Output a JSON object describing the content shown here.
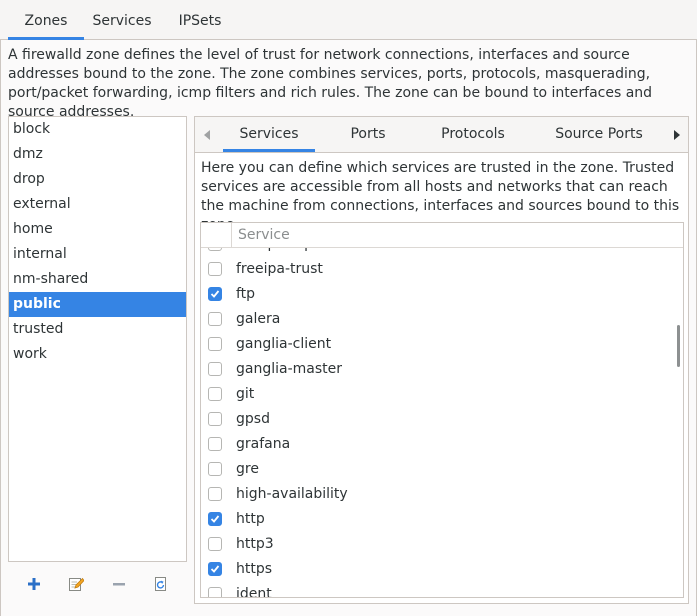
{
  "top_tabs": [
    {
      "label": "Zones",
      "active": true
    },
    {
      "label": "Services",
      "active": false
    },
    {
      "label": "IPSets",
      "active": false
    }
  ],
  "zones_description": "A firewalld zone defines the level of trust for network connections, interfaces and source addresses bound to the zone. The zone combines services, ports, protocols, masquerading, port/packet forwarding, icmp filters and rich rules. The zone can be bound to interfaces and source addresses.",
  "zones": [
    {
      "label": "block"
    },
    {
      "label": "dmz"
    },
    {
      "label": "drop"
    },
    {
      "label": "external"
    },
    {
      "label": "home"
    },
    {
      "label": "internal"
    },
    {
      "label": "nm-shared"
    },
    {
      "label": "public",
      "selected": true
    },
    {
      "label": "trusted"
    },
    {
      "label": "work"
    }
  ],
  "zone_toolbar": {
    "add_icon": "plus-icon",
    "edit_icon": "edit-icon",
    "remove_icon": "minus-icon",
    "reload_icon": "reload-icon"
  },
  "sub_tabs": [
    {
      "label": "Services",
      "active": true
    },
    {
      "label": "Ports",
      "active": false
    },
    {
      "label": "Protocols",
      "active": false
    },
    {
      "label": "Source Ports",
      "active": false
    }
  ],
  "services_description": "Here you can define which services are trusted in the zone. Trusted services are accessible from all hosts and networks that can reach the machine from connections, interfaces and sources bound to this zone.",
  "services_table": {
    "column_header": "Service",
    "rows": [
      {
        "name": "freeipa-replication",
        "checked": false
      },
      {
        "name": "freeipa-trust",
        "checked": false
      },
      {
        "name": "ftp",
        "checked": true
      },
      {
        "name": "galera",
        "checked": false
      },
      {
        "name": "ganglia-client",
        "checked": false
      },
      {
        "name": "ganglia-master",
        "checked": false
      },
      {
        "name": "git",
        "checked": false
      },
      {
        "name": "gpsd",
        "checked": false
      },
      {
        "name": "grafana",
        "checked": false
      },
      {
        "name": "gre",
        "checked": false
      },
      {
        "name": "high-availability",
        "checked": false
      },
      {
        "name": "http",
        "checked": true
      },
      {
        "name": "http3",
        "checked": false
      },
      {
        "name": "https",
        "checked": true
      },
      {
        "name": "ident",
        "checked": false
      }
    ]
  },
  "colors": {
    "accent": "#3584e4",
    "background": "#f6f5f4",
    "border": "#cdc7c2"
  }
}
